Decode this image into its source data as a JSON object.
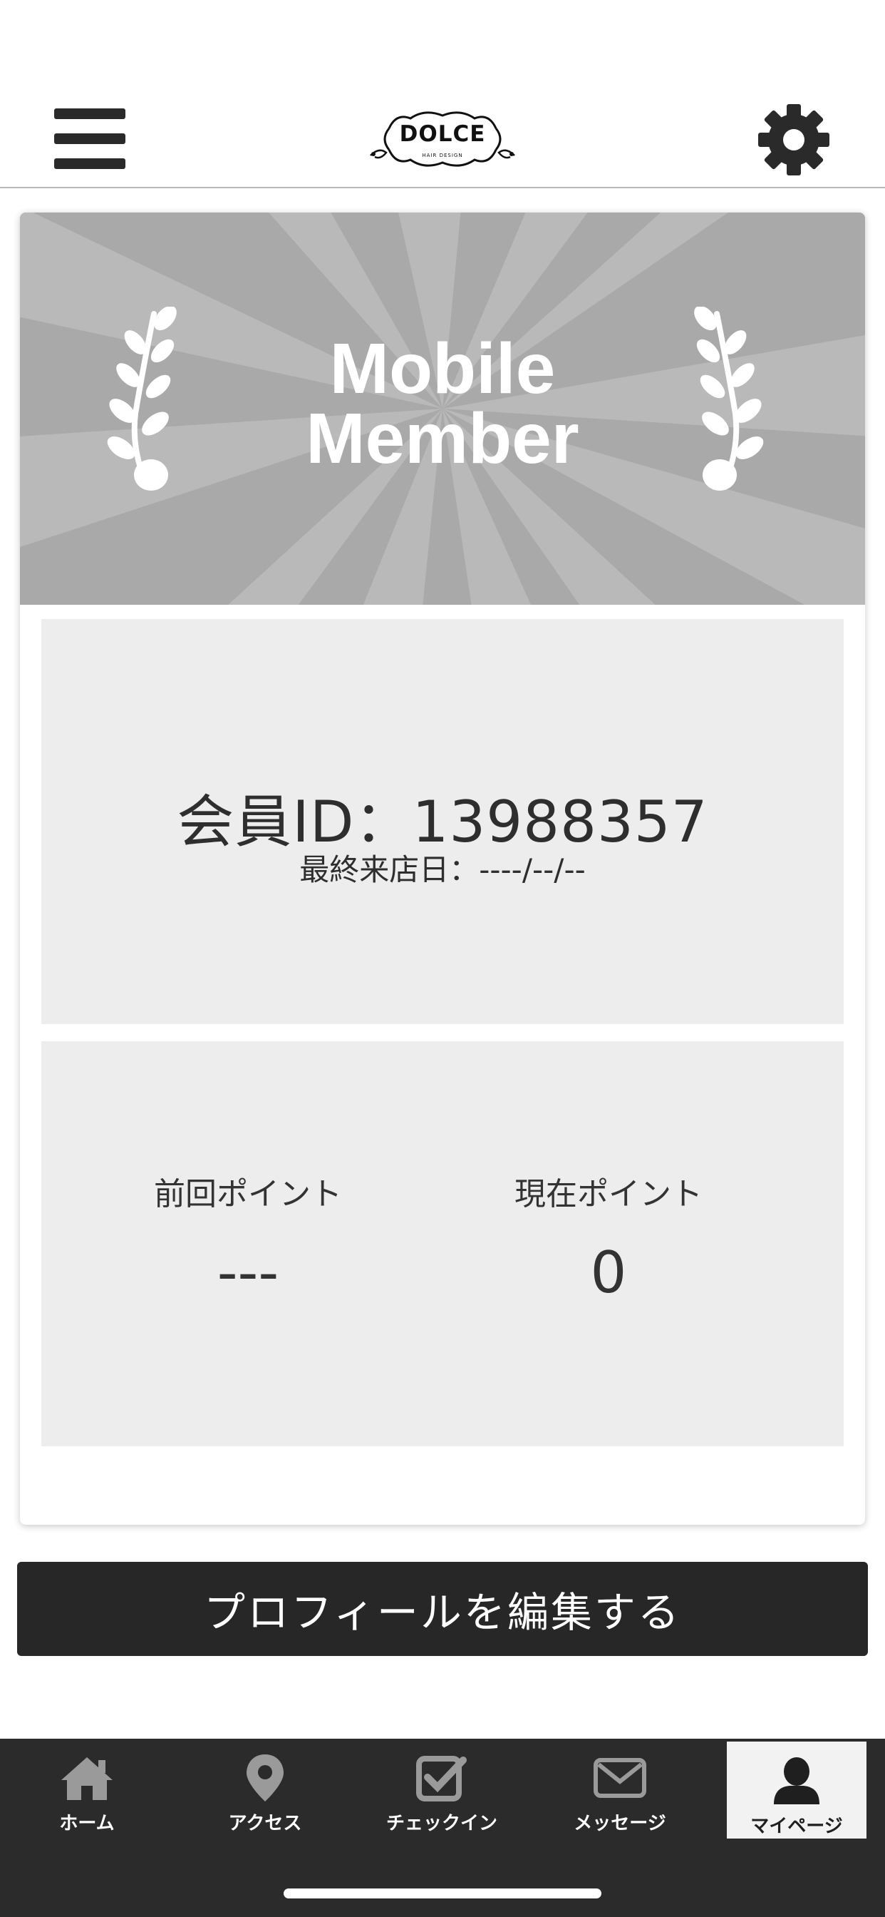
{
  "header": {
    "logo_text": "DOLCE",
    "logo_subtext": "HAIR DESIGN"
  },
  "banner": {
    "title_line1": "Mobile",
    "title_line2": "Member"
  },
  "member": {
    "id_text": "会員ID：13988357",
    "last_visit_text": "最終来店日：----/--/--"
  },
  "points": {
    "previous_label": "前回ポイント",
    "previous_value": "---",
    "current_label": "現在ポイント",
    "current_value": "0"
  },
  "actions": {
    "edit_profile_label": "プロフィールを編集する"
  },
  "tabbar": {
    "items": [
      {
        "label": "ホーム",
        "icon": "home-icon"
      },
      {
        "label": "アクセス",
        "icon": "map-pin-icon"
      },
      {
        "label": "チェックイン",
        "icon": "checkbox-icon"
      },
      {
        "label": "メッセージ",
        "icon": "envelope-icon"
      },
      {
        "label": "マイページ",
        "icon": "person-icon",
        "active": true
      }
    ]
  },
  "colors": {
    "header_icons": "#2a2a2a",
    "banner_bg": "#a9a9a9",
    "panel_bg": "#ededed",
    "button_bg": "#272727",
    "tabbar_bg": "#2b2b2b",
    "tab_active_bg": "#f2f2f2"
  }
}
